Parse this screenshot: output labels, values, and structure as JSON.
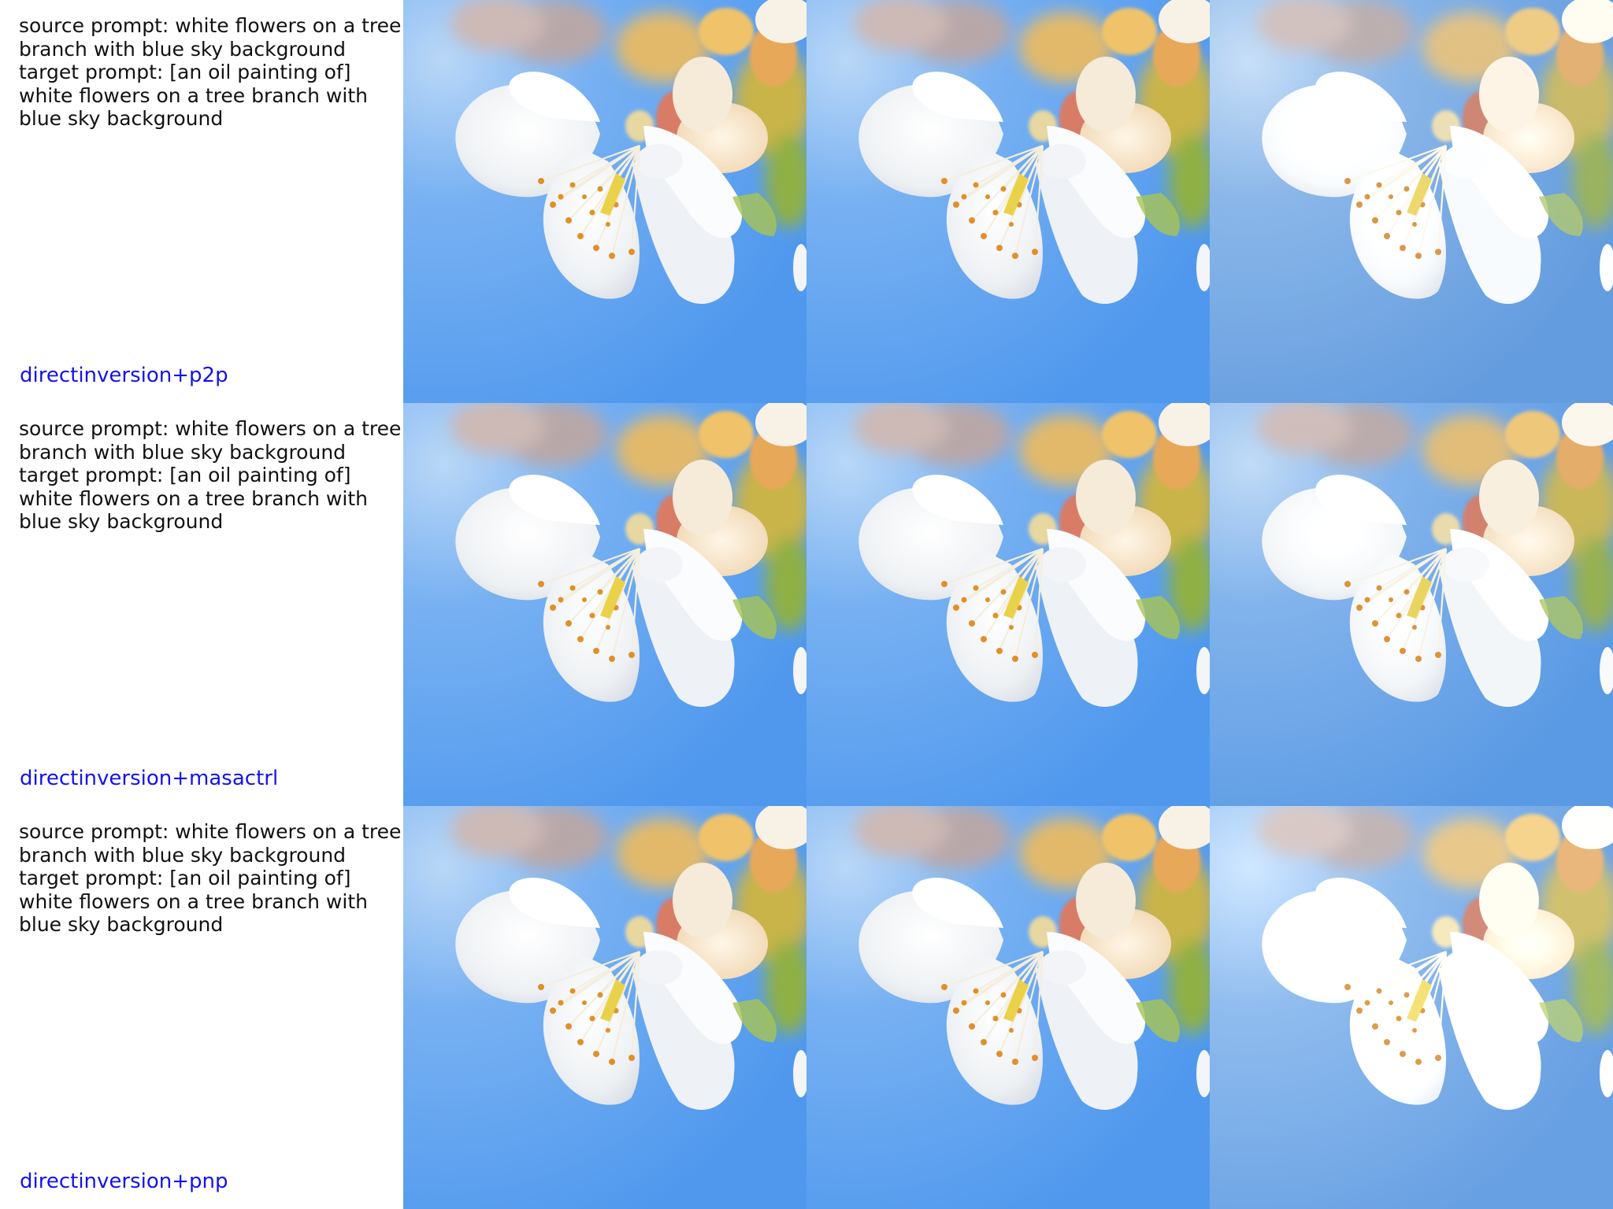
{
  "rows": [
    {
      "method": "directinversion+p2p",
      "prompt_lines": [
        "source prompt: white flowers on a tree",
        "branch with blue sky background",
        "target prompt: [an oil painting of]",
        "white flowers on a tree branch with",
        "blue sky background"
      ],
      "images": [
        "white-blossom-original",
        "white-blossom-reconstruction",
        "white-blossom-edited"
      ]
    },
    {
      "method": "directinversion+masactrl",
      "prompt_lines": [
        "source prompt: white flowers on a tree",
        "branch with blue sky background",
        "target prompt: [an oil painting of]",
        "white flowers on a tree branch with",
        "blue sky background"
      ],
      "images": [
        "white-blossom-original",
        "white-blossom-reconstruction",
        "white-blossom-edited"
      ]
    },
    {
      "method": "directinversion+pnp",
      "prompt_lines": [
        "source prompt: white flowers on a tree",
        "branch with blue sky background",
        "target prompt: [an oil painting of]",
        "white flowers on a tree branch with",
        "blue sky background"
      ],
      "images": [
        "white-blossom-original",
        "white-blossom-reconstruction",
        "white-blossom-edited"
      ]
    }
  ],
  "colors": {
    "sky": "#5a9ff0",
    "sky_light": "#9cc6f5",
    "petal": "#f4f6f8",
    "stamen": "#e0902a",
    "method_label": "#1313ee"
  }
}
